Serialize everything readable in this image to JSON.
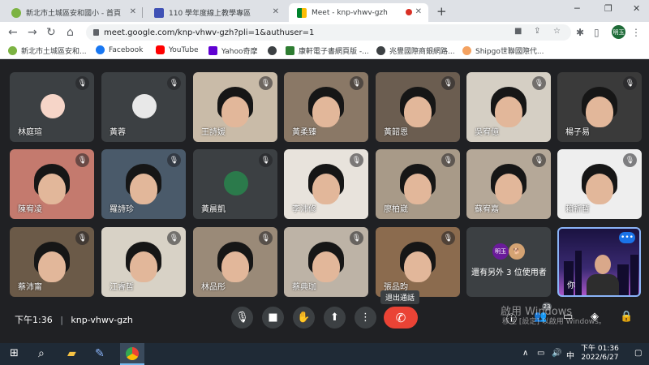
{
  "browser": {
    "tabs": [
      {
        "title": "新北市土城區安和國小 - 首頁",
        "active": false
      },
      {
        "title": "110 學年度線上教學專區",
        "active": false
      },
      {
        "title": "Meet - knp-vhwv-gzh",
        "active": true
      }
    ],
    "address": "meet.google.com/knp-vhwv-gzh?pli=1&authuser=1",
    "profile_initials": "明玉",
    "bookmarks": [
      "新北市土城區安和...",
      "Facebook",
      "YouTube",
      "Yahoo奇摩",
      "康軒電子書網頁版 -...",
      "兆豐國際商銀網路...",
      "Shipgo世聯國際代..."
    ]
  },
  "participants": [
    {
      "name": "林庭瑄",
      "type": "avatar",
      "color": "#f6d5c8"
    },
    {
      "name": "黃蓉",
      "type": "avatar",
      "color": "#e8e8e8"
    },
    {
      "name": "王詩媛",
      "type": "video"
    },
    {
      "name": "黃柔臻",
      "type": "video"
    },
    {
      "name": "黃韶恩",
      "type": "video"
    },
    {
      "name": "吳宥億",
      "type": "video"
    },
    {
      "name": "楊子易",
      "type": "video"
    },
    {
      "name": "陳宥凌",
      "type": "video"
    },
    {
      "name": "羅詩珍",
      "type": "video"
    },
    {
      "name": "黃晨凱",
      "type": "avatar",
      "color": "#2b7a4b"
    },
    {
      "name": "李沛修",
      "type": "video"
    },
    {
      "name": "廖柏崴",
      "type": "video"
    },
    {
      "name": "蘇宥嘉",
      "type": "video"
    },
    {
      "name": "賴祈哲",
      "type": "video"
    },
    {
      "name": "蔡沛甯",
      "type": "video"
    },
    {
      "name": "江睿哲",
      "type": "video"
    },
    {
      "name": "林品彤",
      "type": "video"
    },
    {
      "name": "蔡典珈",
      "type": "video"
    },
    {
      "name": "張品昀",
      "type": "video"
    }
  ],
  "others_tile": {
    "label": "還有另外 3 位使用者",
    "mini_avatar": "明玉"
  },
  "self_tile": {
    "label": "你"
  },
  "controls": {
    "time": "下午1:36",
    "meeting_code": "knp-vhwv-gzh",
    "hangup_tooltip": "退出通話",
    "participant_count": "23"
  },
  "watermark": {
    "line1": "啟用 Windows",
    "line2": "移至 [設定] 以啟用 Windows。"
  },
  "taskbar": {
    "time": "下午 01:36",
    "date": "2022/6/27",
    "ime": "中"
  },
  "colors": {
    "hangup": "#ea4335",
    "self_border": "#8ab4f8",
    "accent": "#1a73e8"
  }
}
